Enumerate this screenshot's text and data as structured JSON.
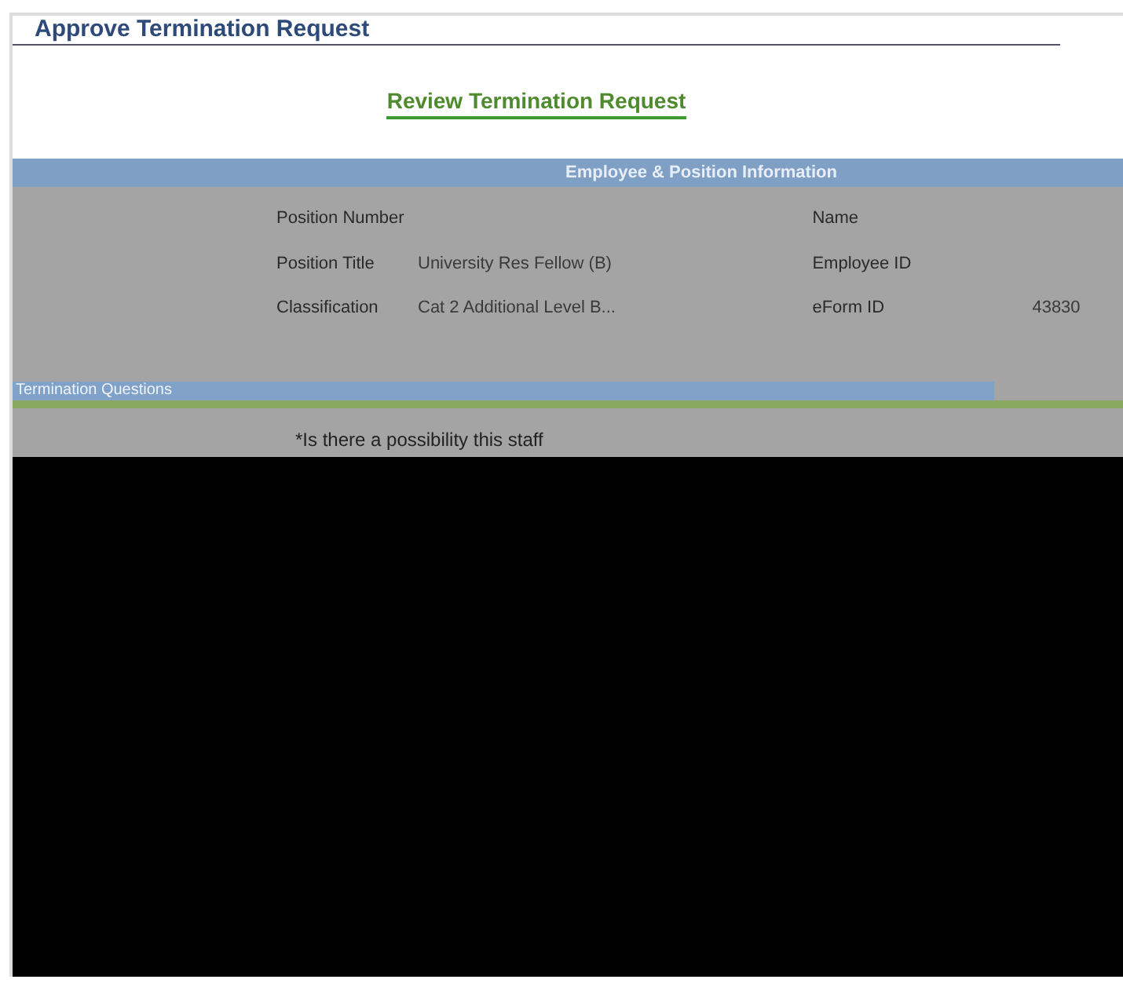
{
  "page_title": "Approve Termination Request",
  "heading": "Review Termination Request",
  "sections": [
    {
      "title": "Employee & Position Information"
    }
  ],
  "fields_left": [
    {
      "label": "Position Number"
    },
    {
      "label": "Position Title",
      "value": "University Res Fellow (B)"
    },
    {
      "label": "Classification",
      "value": "Cat 2 Additional Level B..."
    }
  ],
  "fields_right": [
    {
      "label": "Name"
    },
    {
      "label": "Employee ID"
    },
    {
      "label": "eForm ID",
      "value": "43830"
    }
  ],
  "questions_section": {
    "title": "Termination Questions"
  },
  "question": "*Is there a possibility this staff"
}
